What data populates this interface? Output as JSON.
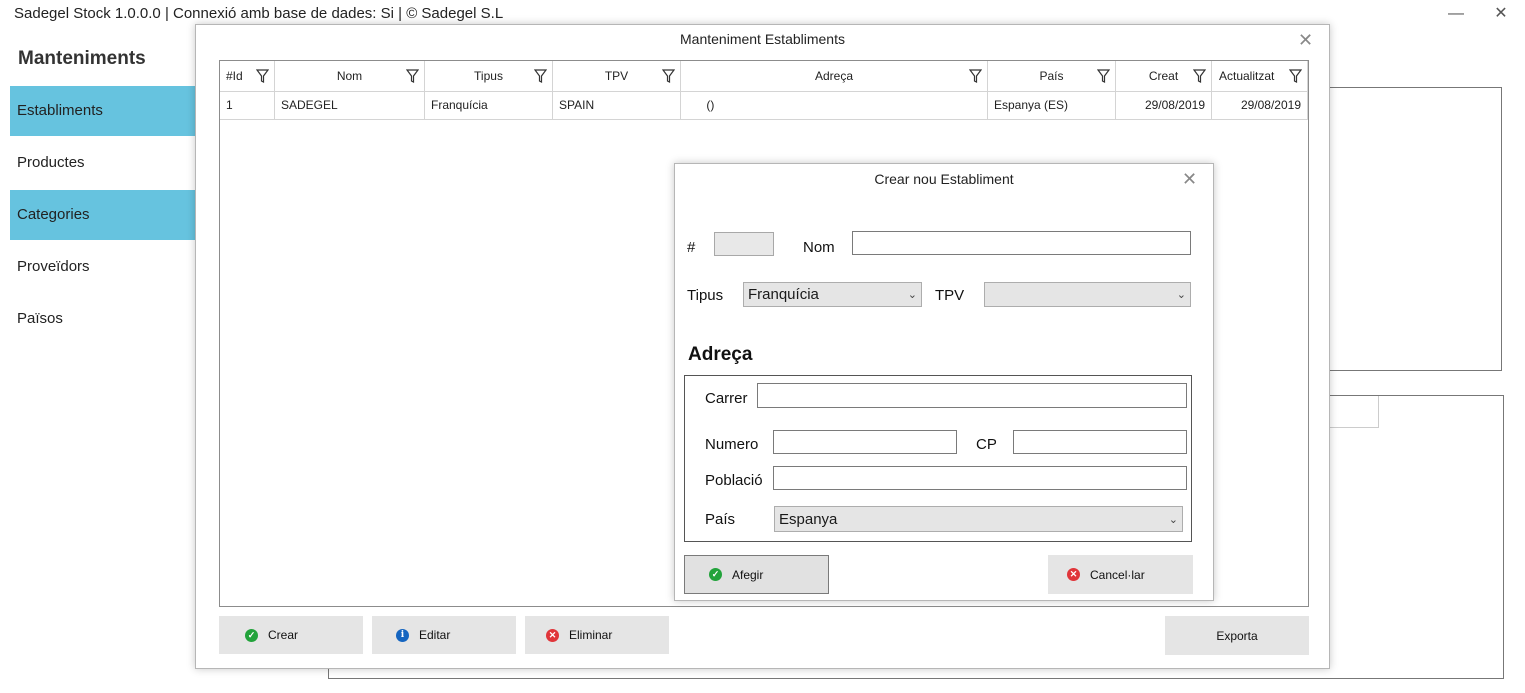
{
  "app": {
    "title": "Sadegel Stock 1.0.0.0 | Connexió amb base de dades: Si | © Sadegel S.L",
    "minimize_glyph": "—",
    "close_glyph": "✕"
  },
  "sidebar": {
    "title": "Manteniments",
    "items": [
      {
        "label": "Establiments",
        "active": true
      },
      {
        "label": "Productes",
        "active": false
      },
      {
        "label": "Categories",
        "active": true
      },
      {
        "label": "Proveïdors",
        "active": false
      },
      {
        "label": "Països",
        "active": false
      }
    ]
  },
  "main_dialog": {
    "title": "Manteniment Establiments",
    "close_glyph": "✕",
    "grid": {
      "columns": [
        "#Id",
        "Nom",
        "Tipus",
        "TPV",
        "Adreça",
        "País",
        "Creat",
        "Actualitzat"
      ],
      "rows": [
        [
          "1",
          "SADEGEL",
          "Franquícia",
          "SPAIN",
          " ()",
          "Espanya (ES)",
          "29/08/2019",
          "29/08/2019"
        ]
      ]
    },
    "buttons": {
      "create": "Crear",
      "edit": "Editar",
      "delete": "Eliminar",
      "export": "Exporta"
    }
  },
  "create_dialog": {
    "title": "Crear nou Establiment",
    "close_glyph": "✕",
    "id_label": "#",
    "id_value": "",
    "name_label": "Nom",
    "name_value": "",
    "type_label": "Tipus",
    "type_value": "Franquícia",
    "tpv_label": "TPV",
    "tpv_value": "",
    "address_heading": "Adreça",
    "street_label": "Carrer",
    "street_value": "",
    "number_label": "Numero",
    "number_value": "",
    "cp_label": "CP",
    "cp_value": "",
    "town_label": "Població",
    "town_value": "",
    "country_label": "País",
    "country_value": "Espanya",
    "add_button": "Afegir",
    "cancel_button": "Cancel·lar"
  },
  "colors": {
    "sidebar_active": "#66c3df",
    "button_bg": "#e5e5e5",
    "icon_ok": "#22a33b",
    "icon_info": "#1565c0",
    "icon_error": "#e0353a"
  }
}
